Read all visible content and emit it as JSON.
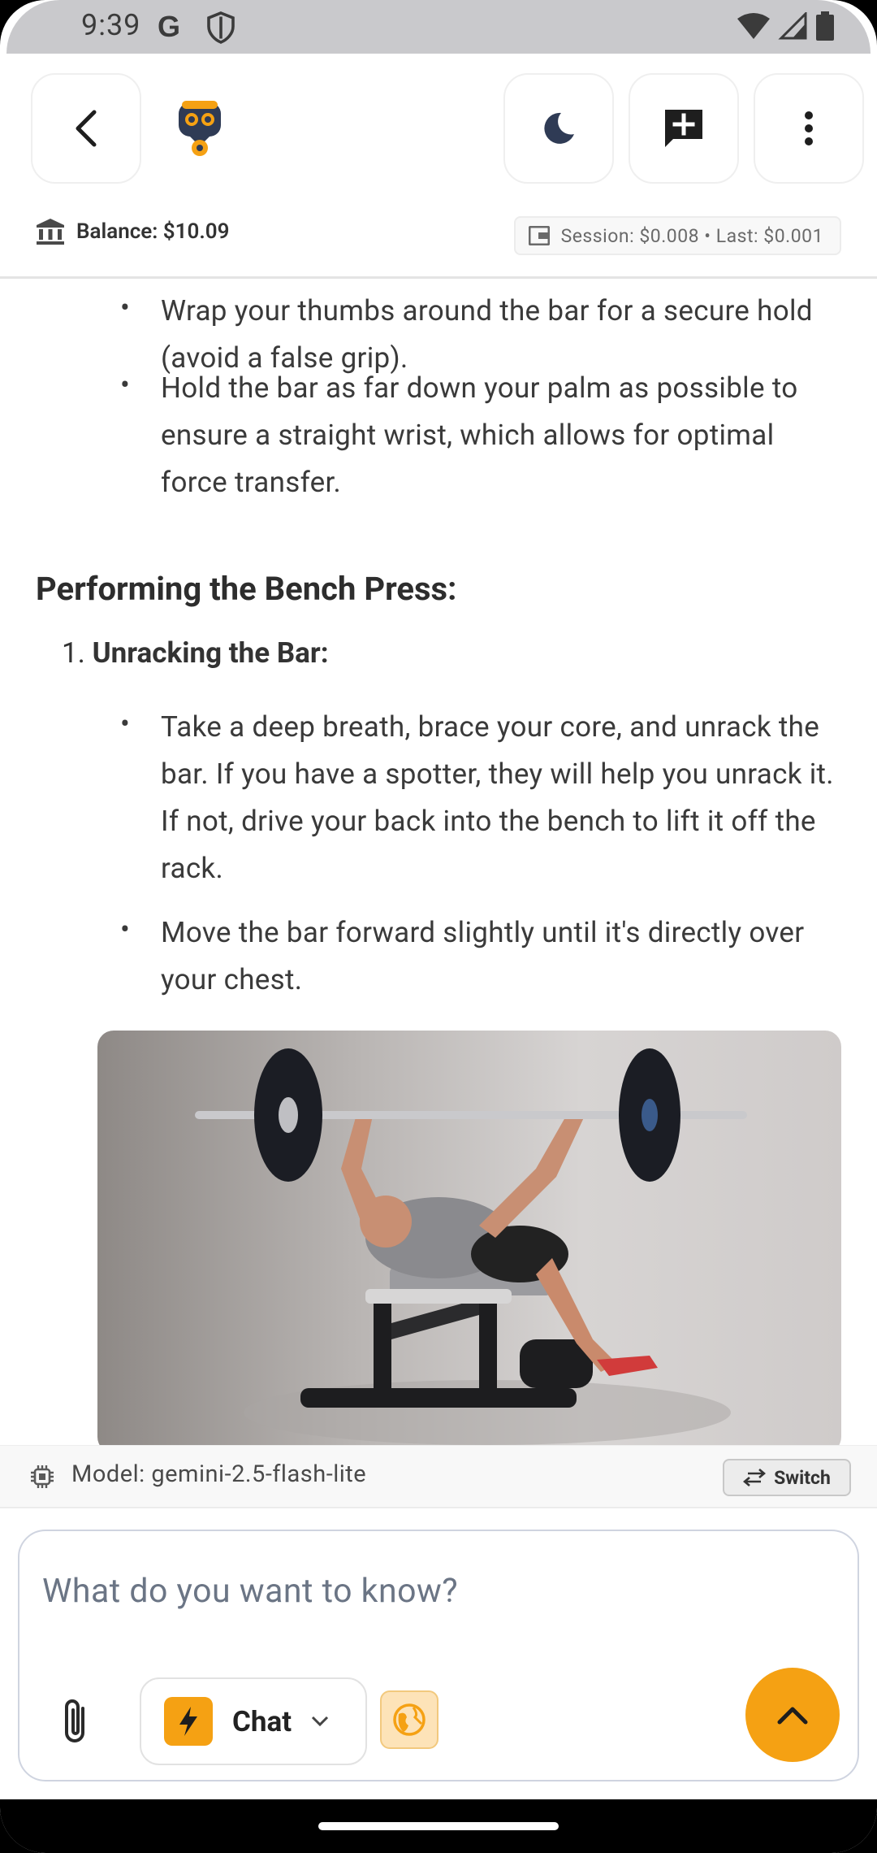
{
  "status": {
    "time": "9:39",
    "left_icons": [
      "google-g-icon",
      "shield-icon"
    ],
    "right_icons": [
      "wifi-icon",
      "signal-icon",
      "battery-icon"
    ]
  },
  "header": {
    "buttons": [
      "back-icon",
      "app-logo",
      "dark-mode-icon",
      "new-chat-icon",
      "more-vert-icon"
    ],
    "balance": "Balance: $10.09",
    "session": "Session: $0.008 • Last: $0.001"
  },
  "content": {
    "bullets_top": [
      "Wrap your thumbs around the bar for a secure hold (avoid a false grip).",
      "Hold the bar as far down your palm as possible to ensure a straight wrist, which allows for optimal force transfer."
    ],
    "heading": "Performing the Bench Press:",
    "step_number": "1.",
    "step_title": "Unracking the Bar:",
    "step_bullets": [
      "Take a deep breath, brace your core, and unrack the bar. If you have a spotter, they will help you unrack it. If not, drive your back into the bench to lift it off the rack.",
      "Move the bar forward slightly until it's directly over your chest."
    ],
    "bullet_char": "•"
  },
  "modelbar": {
    "label": "Model: gemini-2.5-flash-lite",
    "switch_label": "Switch"
  },
  "input": {
    "placeholder": "What do you want to know?",
    "mode_label": "Chat"
  },
  "colors": {
    "accent": "#f5a113",
    "accent_light": "#fde3b8",
    "status_bar": "#c9c9cc"
  }
}
